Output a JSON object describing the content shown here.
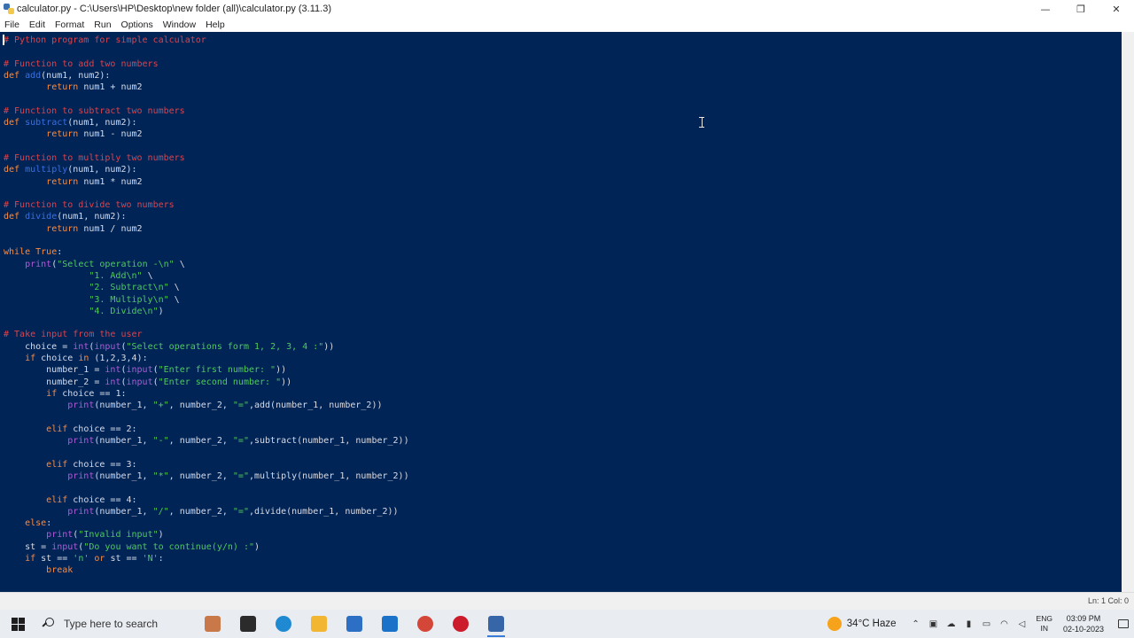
{
  "window": {
    "title": "calculator.py - C:\\Users\\HP\\Desktop\\new folder (all)\\calculator.py (3.11.3)",
    "controls": {
      "minimize": "—",
      "maximize": "❐",
      "close": "✕"
    }
  },
  "menu": [
    "File",
    "Edit",
    "Format",
    "Run",
    "Options",
    "Window",
    "Help"
  ],
  "editor": {
    "background": "#012456",
    "colors": {
      "comment": "#e0424a",
      "keyword": "#ff8a3c",
      "function": "#3b6fe0",
      "builtin": "#b25ad8",
      "string": "#4ecb5a",
      "text": "#d9dbe6"
    },
    "lines": [
      [
        [
          "com",
          "# Python program for simple calculator"
        ]
      ],
      [],
      [
        [
          "com",
          "# Function to add two numbers"
        ]
      ],
      [
        [
          "kw",
          "def "
        ],
        [
          "fn",
          "add"
        ],
        [
          "tx",
          "(num1, num2):"
        ]
      ],
      [
        [
          "tx",
          "        "
        ],
        [
          "kw",
          "return"
        ],
        [
          "tx",
          " num1 + num2"
        ]
      ],
      [],
      [
        [
          "com",
          "# Function to subtract two numbers"
        ]
      ],
      [
        [
          "kw",
          "def "
        ],
        [
          "fn",
          "subtract"
        ],
        [
          "tx",
          "(num1, num2):"
        ]
      ],
      [
        [
          "tx",
          "        "
        ],
        [
          "kw",
          "return"
        ],
        [
          "tx",
          " num1 - num2"
        ]
      ],
      [],
      [
        [
          "com",
          "# Function to multiply two numbers"
        ]
      ],
      [
        [
          "kw",
          "def "
        ],
        [
          "fn",
          "multiply"
        ],
        [
          "tx",
          "(num1, num2):"
        ]
      ],
      [
        [
          "tx",
          "        "
        ],
        [
          "kw",
          "return"
        ],
        [
          "tx",
          " num1 * num2"
        ]
      ],
      [],
      [
        [
          "com",
          "# Function to divide two numbers"
        ]
      ],
      [
        [
          "kw",
          "def "
        ],
        [
          "fn",
          "divide"
        ],
        [
          "tx",
          "(num1, num2):"
        ]
      ],
      [
        [
          "tx",
          "        "
        ],
        [
          "kw",
          "return"
        ],
        [
          "tx",
          " num1 / num2"
        ]
      ],
      [],
      [
        [
          "kw",
          "while"
        ],
        [
          "tx",
          " "
        ],
        [
          "kw",
          "True"
        ],
        [
          "tx",
          ":"
        ]
      ],
      [
        [
          "tx",
          "    "
        ],
        [
          "bi",
          "print"
        ],
        [
          "tx",
          "("
        ],
        [
          "str",
          "\"Select operation -\\n\""
        ],
        [
          "tx",
          " \\"
        ]
      ],
      [
        [
          "tx",
          "                "
        ],
        [
          "str",
          "\"1. Add\\n\""
        ],
        [
          "tx",
          " \\"
        ]
      ],
      [
        [
          "tx",
          "                "
        ],
        [
          "str",
          "\"2. Subtract\\n\""
        ],
        [
          "tx",
          " \\"
        ]
      ],
      [
        [
          "tx",
          "                "
        ],
        [
          "str",
          "\"3. Multiply\\n\""
        ],
        [
          "tx",
          " \\"
        ]
      ],
      [
        [
          "tx",
          "                "
        ],
        [
          "str",
          "\"4. Divide\\n\""
        ],
        [
          "tx",
          ")"
        ]
      ],
      [],
      [
        [
          "com",
          "# Take input from the user"
        ]
      ],
      [
        [
          "tx",
          "    choice = "
        ],
        [
          "bi",
          "int"
        ],
        [
          "tx",
          "("
        ],
        [
          "bi",
          "input"
        ],
        [
          "tx",
          "("
        ],
        [
          "str",
          "\"Select operations form 1, 2, 3, 4 :\""
        ],
        [
          "tx",
          "))"
        ]
      ],
      [
        [
          "tx",
          "    "
        ],
        [
          "kw",
          "if"
        ],
        [
          "tx",
          " choice "
        ],
        [
          "kw",
          "in"
        ],
        [
          "tx",
          " (1,2,3,4):"
        ]
      ],
      [
        [
          "tx",
          "        number_1 = "
        ],
        [
          "bi",
          "int"
        ],
        [
          "tx",
          "("
        ],
        [
          "bi",
          "input"
        ],
        [
          "tx",
          "("
        ],
        [
          "str",
          "\"Enter first number: \""
        ],
        [
          "tx",
          "))"
        ]
      ],
      [
        [
          "tx",
          "        number_2 = "
        ],
        [
          "bi",
          "int"
        ],
        [
          "tx",
          "("
        ],
        [
          "bi",
          "input"
        ],
        [
          "tx",
          "("
        ],
        [
          "str",
          "\"Enter second number: \""
        ],
        [
          "tx",
          "))"
        ]
      ],
      [
        [
          "tx",
          "        "
        ],
        [
          "kw",
          "if"
        ],
        [
          "tx",
          " choice == 1:"
        ]
      ],
      [
        [
          "tx",
          "            "
        ],
        [
          "bi",
          "print"
        ],
        [
          "tx",
          "(number_1, "
        ],
        [
          "str",
          "\"+\""
        ],
        [
          "tx",
          ", number_2, "
        ],
        [
          "str",
          "\"=\""
        ],
        [
          "tx",
          ",add(number_1, number_2))"
        ]
      ],
      [],
      [
        [
          "tx",
          "        "
        ],
        [
          "kw",
          "elif"
        ],
        [
          "tx",
          " choice == 2:"
        ]
      ],
      [
        [
          "tx",
          "            "
        ],
        [
          "bi",
          "print"
        ],
        [
          "tx",
          "(number_1, "
        ],
        [
          "str",
          "\"-\""
        ],
        [
          "tx",
          ", number_2, "
        ],
        [
          "str",
          "\"=\""
        ],
        [
          "tx",
          ",subtract(number_1, number_2))"
        ]
      ],
      [],
      [
        [
          "tx",
          "        "
        ],
        [
          "kw",
          "elif"
        ],
        [
          "tx",
          " choice == 3:"
        ]
      ],
      [
        [
          "tx",
          "            "
        ],
        [
          "bi",
          "print"
        ],
        [
          "tx",
          "(number_1, "
        ],
        [
          "str",
          "\"*\""
        ],
        [
          "tx",
          ", number_2, "
        ],
        [
          "str",
          "\"=\""
        ],
        [
          "tx",
          ",multiply(number_1, number_2))"
        ]
      ],
      [],
      [
        [
          "tx",
          "        "
        ],
        [
          "kw",
          "elif"
        ],
        [
          "tx",
          " choice == 4:"
        ]
      ],
      [
        [
          "tx",
          "            "
        ],
        [
          "bi",
          "print"
        ],
        [
          "tx",
          "(number_1, "
        ],
        [
          "str",
          "\"/\""
        ],
        [
          "tx",
          ", number_2, "
        ],
        [
          "str",
          "\"=\""
        ],
        [
          "tx",
          ",divide(number_1, number_2))"
        ]
      ],
      [
        [
          "tx",
          "    "
        ],
        [
          "kw",
          "else"
        ],
        [
          "tx",
          ":"
        ]
      ],
      [
        [
          "tx",
          "        "
        ],
        [
          "bi",
          "print"
        ],
        [
          "tx",
          "("
        ],
        [
          "str",
          "\"Invalid input\""
        ],
        [
          "tx",
          ")"
        ]
      ],
      [
        [
          "tx",
          "    st = "
        ],
        [
          "bi",
          "input"
        ],
        [
          "tx",
          "("
        ],
        [
          "str",
          "\"Do you want to continue(y/n) :\""
        ],
        [
          "tx",
          ")"
        ]
      ],
      [
        [
          "tx",
          "    "
        ],
        [
          "kw",
          "if"
        ],
        [
          "tx",
          " st == "
        ],
        [
          "str",
          "'n'"
        ],
        [
          "tx",
          " "
        ],
        [
          "kw",
          "or"
        ],
        [
          "tx",
          " st == "
        ],
        [
          "str",
          "'N'"
        ],
        [
          "tx",
          ":"
        ]
      ],
      [
        [
          "tx",
          "        "
        ],
        [
          "kw",
          "break"
        ]
      ]
    ]
  },
  "status": {
    "position": "Ln: 1   Col: 0"
  },
  "taskbar": {
    "search_placeholder": "Type here to search",
    "apps": [
      {
        "name": "cortana-icon",
        "color": "#c9784a"
      },
      {
        "name": "task-view-icon",
        "color": "#2b2b2b"
      },
      {
        "name": "edge-icon",
        "color": "#1f8ad2"
      },
      {
        "name": "file-explorer-icon",
        "color": "#f2b632"
      },
      {
        "name": "store-icon",
        "color": "#2d6fc4"
      },
      {
        "name": "mail-icon",
        "color": "#1a73c9"
      },
      {
        "name": "chrome-icon",
        "color": "#d44638"
      },
      {
        "name": "opera-icon",
        "color": "#cc1b2b"
      },
      {
        "name": "idle-icon",
        "color": "#3766a8"
      }
    ],
    "weather": "34°C  Haze",
    "language": {
      "line1": "ENG",
      "line2": "IN"
    },
    "clock": {
      "time": "03:09 PM",
      "date": "02-10-2023"
    },
    "tray_icons": [
      "chevron-up-icon",
      "meet-now-icon",
      "onedrive-icon",
      "battery-icon",
      "network-icon",
      "wifi-icon",
      "speaker-icon"
    ]
  }
}
